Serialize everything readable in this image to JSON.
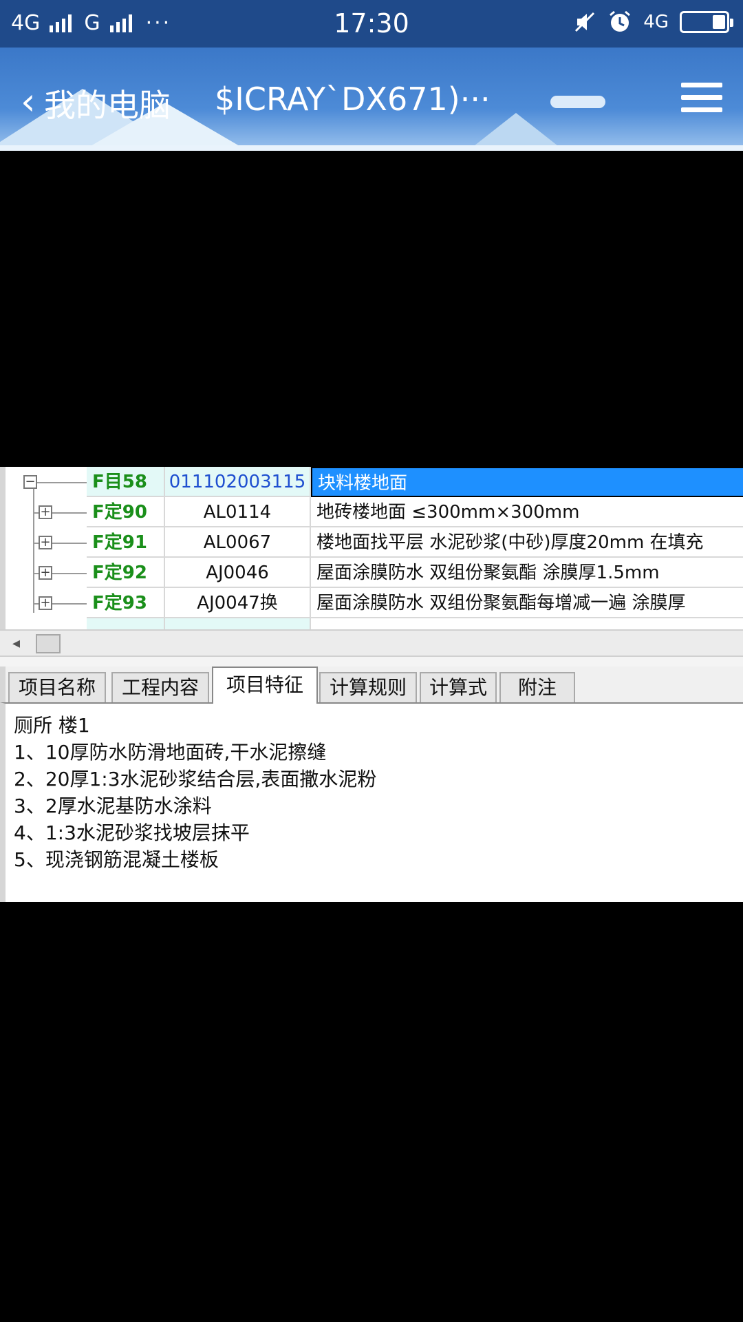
{
  "status_bar": {
    "net1": "4G",
    "net2": "G",
    "dots": "···",
    "time": "17:30",
    "net3": "4G"
  },
  "header": {
    "title": "我的电脑",
    "subtitle": "$ICRAY`DX671)···"
  },
  "tree": {
    "rows": [
      {
        "type": "F目58",
        "code": "011102003115",
        "name": "块料楼地面"
      },
      {
        "type": "F定90",
        "code": "AL0114",
        "name": "地砖楼地面 ≤300mm×300mm"
      },
      {
        "type": "F定91",
        "code": "AL0067",
        "name": "楼地面找平层 水泥砂浆(中砂)厚度20mm 在填充"
      },
      {
        "type": "F定92",
        "code": "AJ0046",
        "name": "屋面涂膜防水 双组份聚氨酯 涂膜厚1.5mm"
      },
      {
        "type": "F定93",
        "code": "AJ0047换",
        "name": "屋面涂膜防水 双组份聚氨酯每增减一遍 涂膜厚"
      }
    ]
  },
  "tabs": [
    {
      "label": "项目名称"
    },
    {
      "label": "工程内容"
    },
    {
      "label": "项目特征"
    },
    {
      "label": "计算规则"
    },
    {
      "label": "计算式"
    },
    {
      "label": "附注"
    }
  ],
  "content": {
    "lines": [
      "厕所 楼1",
      "1、10厚防水防滑地面砖,干水泥擦缝",
      "2、20厚1:3水泥砂浆结合层,表面撒水泥粉",
      "3、2厚水泥基防水涂料",
      "4、1:3水泥砂浆找坡层抹平",
      "5、现浇钢筋混凝土楼板"
    ]
  }
}
